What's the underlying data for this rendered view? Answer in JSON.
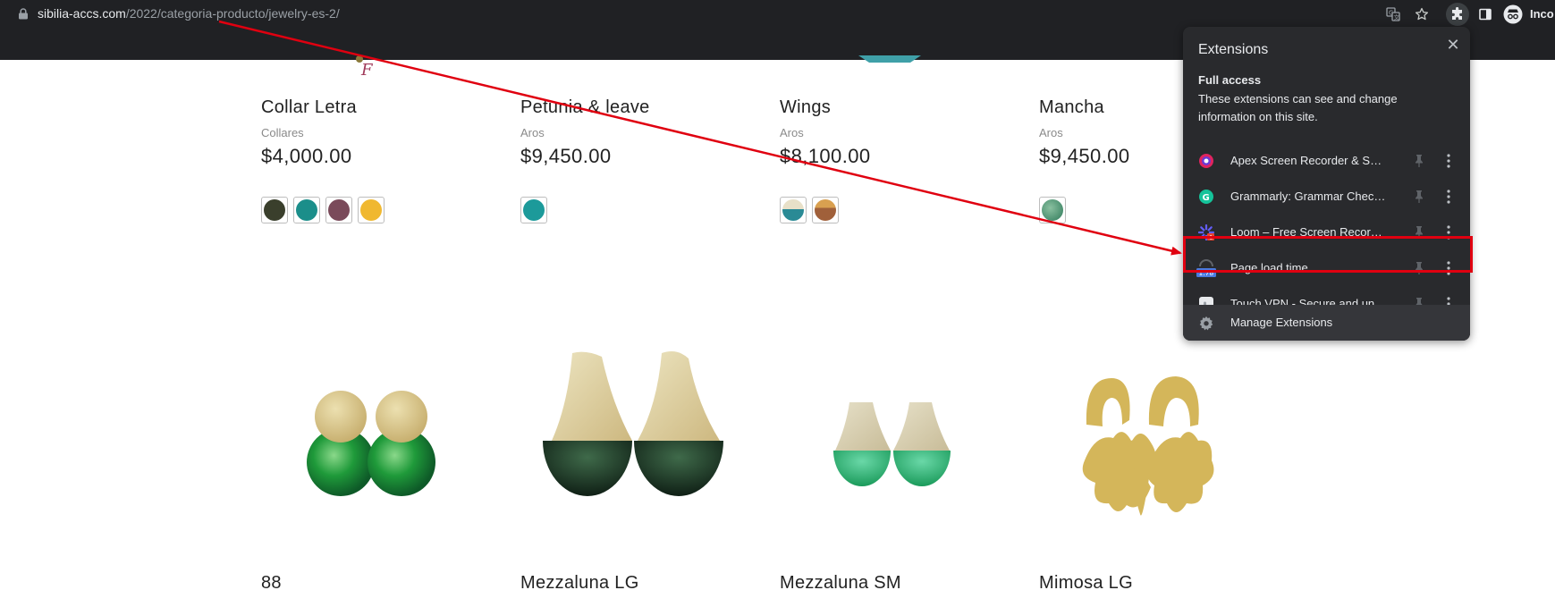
{
  "browser": {
    "url_host": "sibilia-accs.com",
    "url_path": "/2022/categoria-producto/jewelry-es-2/",
    "profile_label": "Inco"
  },
  "products_top": [
    {
      "name": "Collar Letra",
      "category": "Collares",
      "price": "$4,000.00",
      "swatches": [
        "#3a3f2c",
        "#1b8e8a",
        "#7a4a5a",
        "#f0b830"
      ]
    },
    {
      "name": "Petunia & leave",
      "category": "Aros",
      "price": "$9,450.00",
      "swatches": [
        "#1c9a9a"
      ]
    },
    {
      "name": "Wings",
      "category": "Aros",
      "price": "$8,100.00",
      "swatches": [
        "#2a8a95",
        "#c08a3a"
      ]
    },
    {
      "name": "Mancha",
      "category": "Aros",
      "price": "$9,450.00",
      "swatches": [
        "#3f8a6a"
      ]
    }
  ],
  "products_bottom": [
    {
      "name": "88"
    },
    {
      "name": "Mezzaluna LG"
    },
    {
      "name": "Mezzaluna SM"
    },
    {
      "name": "Mimosa LG"
    }
  ],
  "extensions_popup": {
    "title": "Extensions",
    "close_icon": "close-icon",
    "section_title": "Full access",
    "section_desc": "These extensions can see and change information on this site.",
    "items": [
      {
        "name": "Apex Screen Recorder & Screenshot",
        "icon": "apex-icon",
        "color": "#e0245e"
      },
      {
        "name": "Grammarly: Grammar Checker and Writing App",
        "icon": "grammarly-icon",
        "color": "#15c39a"
      },
      {
        "name": "Loom – Free Screen Recorder & Screen Capture",
        "icon": "loom-icon",
        "color": "#625df5",
        "badge": "1"
      },
      {
        "name": "Page load time",
        "icon": "page-load-time-icon",
        "badge": "1.78"
      },
      {
        "name": "Touch VPN - Secure and unlimited VPN proxy",
        "icon": "touch-vpn-icon"
      }
    ],
    "manage_label": "Manage Extensions"
  },
  "annotation": {
    "color": "#e00010"
  }
}
